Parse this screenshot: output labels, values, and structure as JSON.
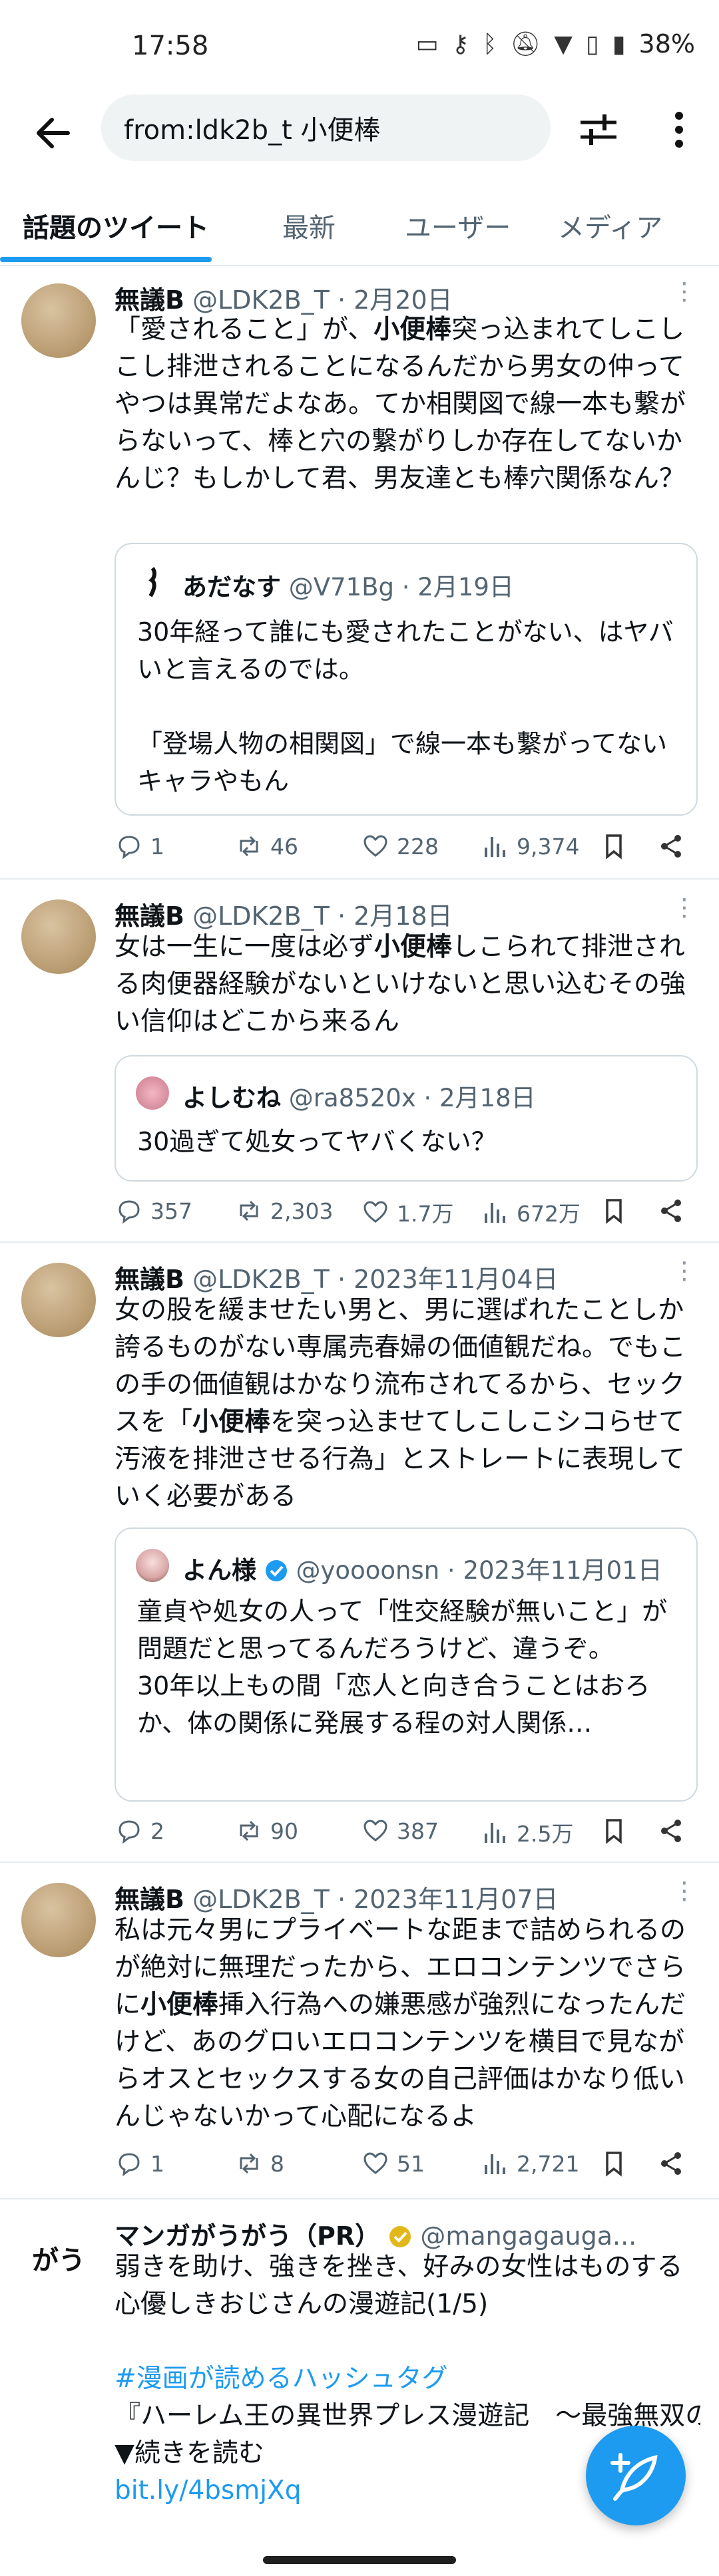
{
  "status": {
    "time": "17:58",
    "battery": "38%"
  },
  "search": {
    "query": "from:ldk2b_t 小便棒"
  },
  "tabs": [
    "話題のツイート",
    "最新",
    "ユーザー",
    "メディア"
  ],
  "tweets": [
    {
      "name": "無議B",
      "meta": "@LDK2B_T · 2月20日",
      "text_pre": "「愛されること」が、",
      "text_kw": "小便棒",
      "text_post": "突っ込まれてしこしこし排泄されることになるんだから男女の仲ってやつは異常だよなあ。てか相関図で線一本も繋がらないって、棒と穴の繋がりしか存在してないかんじ？もしかして君、男友達とも棒穴関係なん？",
      "quote": {
        "name": "あだなす",
        "meta": "@V71Bg · 2月19日",
        "text": "30年経って誰にも愛されたことがない、はヤバいと言えるのでは。\n\n「登場人物の相関図」で線一本も繋がってないキャラやもん"
      },
      "replies": "1",
      "retweets": "46",
      "likes": "228",
      "views": "9,374"
    },
    {
      "name": "無議B",
      "meta": "@LDK2B_T · 2月18日",
      "text_pre": "女は一生に一度は必ず",
      "text_kw": "小便棒",
      "text_post": "しこられて排泄される肉便器経験がないといけないと思い込むその強い信仰はどこから来るん",
      "quote": {
        "name": "よしむね",
        "meta": "@ra8520x · 2月18日",
        "text": "30過ぎて処女ってヤバくない？"
      },
      "replies": "357",
      "retweets": "2,303",
      "likes": "1.7万",
      "views": "672万"
    },
    {
      "name": "無議B",
      "meta": "@LDK2B_T · 2023年11月04日",
      "text_pre": "女の股を緩ませたい男と、男に選ばれたことしか誇るものがない専属売春婦の価値観だね。でもこの手の価値観はかなり流布されてるから、セックスを「",
      "text_kw": "小便棒",
      "text_post": "を突っ込ませてしこしこシコらせて汚液を排泄させる行為」とストレートに表現していく必要がある",
      "quote": {
        "name": "よん様",
        "meta": "@yoooonsn · 2023年11月01日",
        "text": "童貞や処女の人って「性交経験が無いこと」が問題だと思ってるんだろうけど、違うぞ。\n30年以上もの間「恋人と向き合うことはおろか、体の関係に発展する程の対人関係…"
      },
      "replies": "2",
      "retweets": "90",
      "likes": "387",
      "views": "2.5万"
    },
    {
      "name": "無議B",
      "meta": "@LDK2B_T · 2023年11月07日",
      "text_pre": "私は元々男にプライベートな距まで詰められるのが絶対に無理だったから、エロコンテンツでさらに",
      "text_kw": "小便棒",
      "text_post": "挿入行為への嫌悪感が強烈になったんだけど、あのグロいエロコンテンツを横目で見ながらオスとセックスする女の自己評価はかなり低いんじゃないかって心配になるよ",
      "replies": "1",
      "retweets": "8",
      "likes": "51",
      "views": "2,721"
    }
  ],
  "ad": {
    "name": "マンガがうがう（PR）",
    "handle": "@mangagauga...",
    "avatar_text": "がう",
    "text": "弱きを助け、強きを挫き、好みの女性はものする心優しきおじさんの漫遊記(1/5)",
    "hashtag": "#漫画が読めるハッシュタグ",
    "line2": "『ハーレム王の異世界プレス漫遊記　〜最強無双のおじさんはあらゆる種族を嫁にする〜』",
    "line3": "▼続きを読む",
    "link": "bit.ly/4bsmjXq"
  }
}
